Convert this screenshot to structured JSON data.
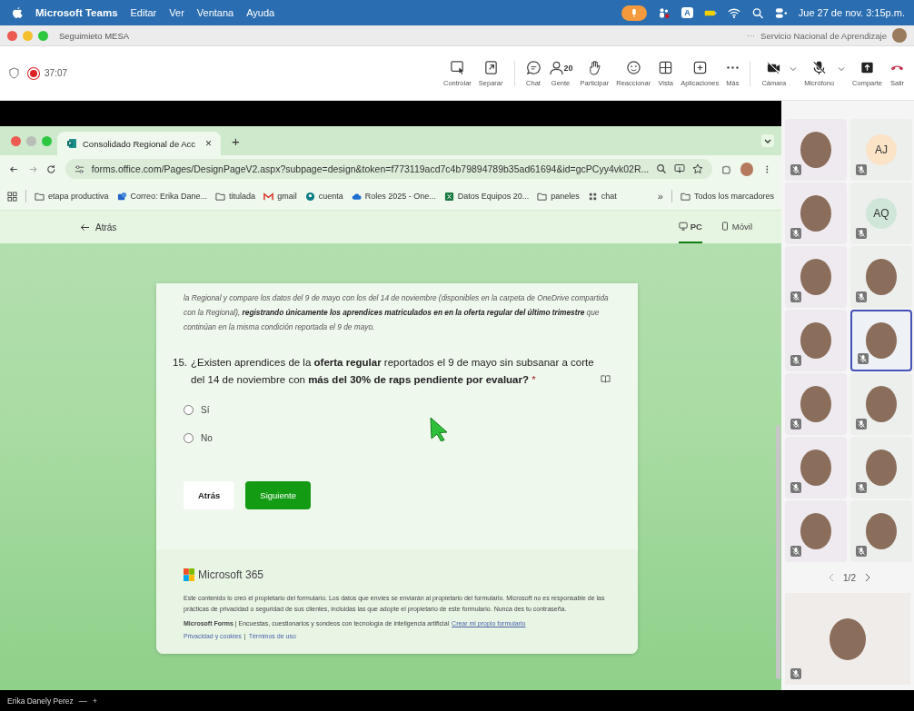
{
  "menubar": {
    "app": "Microsoft Teams",
    "menus": [
      "Editar",
      "Ver",
      "Ventana",
      "Ayuda"
    ],
    "keyboard": "A",
    "clock": "Jue 27 de nov. 3:15p.m."
  },
  "meeting_window": {
    "title": "Seguimieto MESA",
    "more": "···",
    "organization": "Servicio Nacional de Aprendizaje"
  },
  "meeting_toolbar": {
    "timer": "37:07",
    "recording": true,
    "actions": [
      {
        "kind": "control",
        "label": "Controlar"
      },
      {
        "kind": "separate",
        "label": "Separar"
      },
      {
        "kind": "chat",
        "label": "Chat"
      },
      {
        "kind": "people",
        "label": "Gente",
        "count": "20"
      },
      {
        "kind": "hand",
        "label": "Participar"
      },
      {
        "kind": "react",
        "label": "Reaccionar"
      },
      {
        "kind": "view",
        "label": "Vista"
      },
      {
        "kind": "apps",
        "label": "Aplicaciones"
      },
      {
        "kind": "more",
        "label": "Más"
      },
      {
        "kind": "camera",
        "label": "Cámara"
      },
      {
        "kind": "mic",
        "label": "Micrófono"
      },
      {
        "kind": "share",
        "label": "Comparte"
      },
      {
        "kind": "leave",
        "label": "Salir"
      }
    ]
  },
  "browser": {
    "tab_title": "Consolidado Regional de Acc",
    "tab_close": "×",
    "new_tab": "+",
    "url": "forms.office.com/Pages/DesignPageV2.aspx?subpage=design&token=f773119acd7c4b79894789b35ad61694&id=gcPCyy4vk02R...",
    "bookmarks": [
      {
        "kind": "folder",
        "label": "etapa productiva"
      },
      {
        "kind": "mail",
        "label": "Correo: Erika Dane..."
      },
      {
        "kind": "folder",
        "label": "titulada"
      },
      {
        "kind": "gmail",
        "label": "gmail"
      },
      {
        "kind": "account",
        "label": "cuenta"
      },
      {
        "kind": "cloud",
        "label": "Roles 2025 - One..."
      },
      {
        "kind": "sheet",
        "label": "Datos Equipos 20..."
      },
      {
        "kind": "folder",
        "label": "paneles"
      },
      {
        "kind": "grid",
        "label": "chat"
      }
    ],
    "overflow": "»",
    "all_bookmarks": "Todos los marcadores"
  },
  "forms_header": {
    "back": "Atrás",
    "views": [
      {
        "kind": "desktop",
        "label": "PC",
        "selected": true
      },
      {
        "kind": "phone",
        "label": "Móvil",
        "selected": false
      }
    ]
  },
  "form": {
    "intro": "la Regional y compare los datos del 9 de mayo con los del 14 de noviembre (disponibles en la carpeta de OneDrive compartida con la Regional), **registrando únicamente los aprendices matriculados en en la oferta regular del último trimestre** que continúan en la misma condición reportada el 9 de mayo.",
    "question": {
      "number": "15.",
      "text": "¿Existen aprendices de la **oferta regular** reportados  el 9 de mayo sin subsanar a corte del 14 de noviembre con **más del 30% de raps pendiente por evaluar?**",
      "required": "*",
      "options": [
        {
          "label": "Sí",
          "selected": false
        },
        {
          "label": "No",
          "selected": false
        }
      ]
    },
    "back_button": "Atrás",
    "next_button": "Siguiente",
    "footer": {
      "brand": "Microsoft 365",
      "disclaimer": "Este contenido lo creó el propietario del formulario. Los datos que envíes se enviarán al propietario del formulario. Microsoft no es responsable de las prácticas de privacidad o seguridad de sus clientes, incluidas las que adopte el propietario de este formulario. Nunca des tu contraseña.",
      "tagline": "**Microsoft Forms** | Encuestas, cuestionarios y sondeos con tecnología de inteligencia artificial",
      "create_link": "Crear mi propio formulario",
      "privacy": "Privacidad y cookies",
      "separator": "|",
      "terms": "Términos de uso"
    }
  },
  "participants": [
    {
      "kind": "photo",
      "highlighted": false
    },
    {
      "kind": "initials",
      "initials": "AJ",
      "color": "#fbe3c8",
      "highlighted": false
    },
    {
      "kind": "photo",
      "highlighted": false
    },
    {
      "kind": "initials",
      "initials": "AQ",
      "color": "#cfe6d9",
      "highlighted": false
    },
    {
      "kind": "photo",
      "highlighted": false
    },
    {
      "kind": "photo",
      "highlighted": false
    },
    {
      "kind": "photo",
      "highlighted": false
    },
    {
      "kind": "photo",
      "highlighted": true
    },
    {
      "kind": "photo",
      "highlighted": false
    },
    {
      "kind": "photo",
      "highlighted": false
    },
    {
      "kind": "photo",
      "highlighted": false
    },
    {
      "kind": "photo",
      "highlighted": false
    },
    {
      "kind": "photo",
      "highlighted": false
    },
    {
      "kind": "photo",
      "highlighted": false
    }
  ],
  "pager": "1/2",
  "self_view": {
    "kind": "photo"
  },
  "presenter_bar": {
    "name": "Erika Danely Perez",
    "controls": [
      "—",
      "+"
    ]
  }
}
